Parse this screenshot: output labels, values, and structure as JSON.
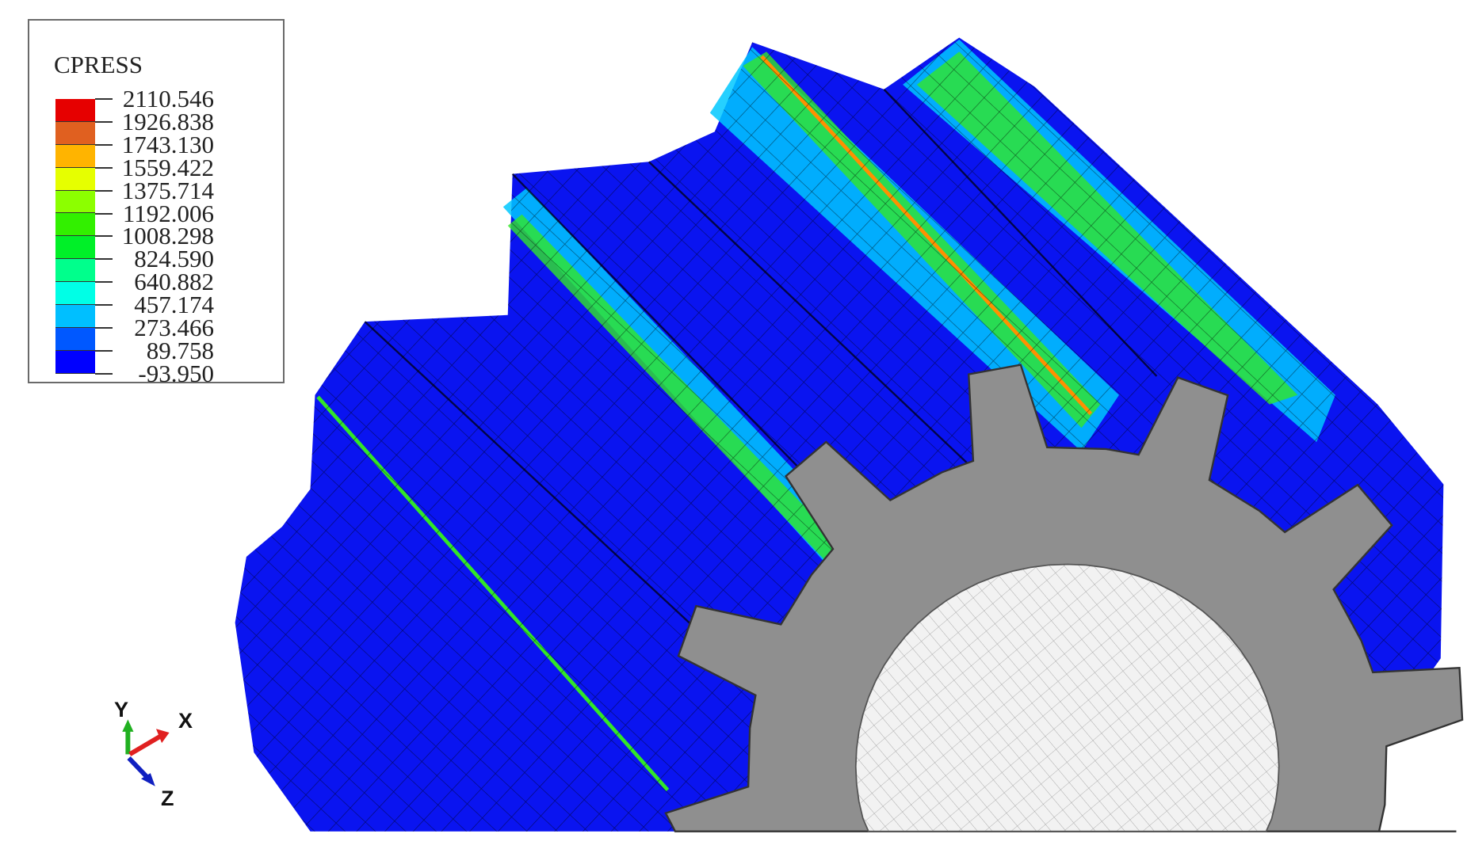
{
  "legend": {
    "title": "CPRESS",
    "values": [
      "2110.546",
      "1926.838",
      "1743.130",
      "1559.422",
      "1375.714",
      "1192.006",
      "1008.298",
      "824.590",
      "640.882",
      "457.174",
      "273.466",
      "89.758",
      "-93.950"
    ],
    "colors": [
      "#e60000",
      "#e06020",
      "#ffb400",
      "#e6ff00",
      "#8cff00",
      "#32f000",
      "#00f028",
      "#00ff8c",
      "#00ffe6",
      "#00bfff",
      "#0058ff",
      "#0000ff"
    ]
  },
  "triad": {
    "y_label": "Y",
    "x_label": "X",
    "z_label": "Z",
    "x_color": "#e02020",
    "y_color": "#20b020",
    "z_color": "#1020c0"
  },
  "model_colors": {
    "body": "#0a14f0",
    "face": "#8f8f8f",
    "bore": "#f2f2f2",
    "contact_low": "#00c8ff",
    "contact_mid": "#32e628",
    "contact_high": "#ff9000"
  }
}
